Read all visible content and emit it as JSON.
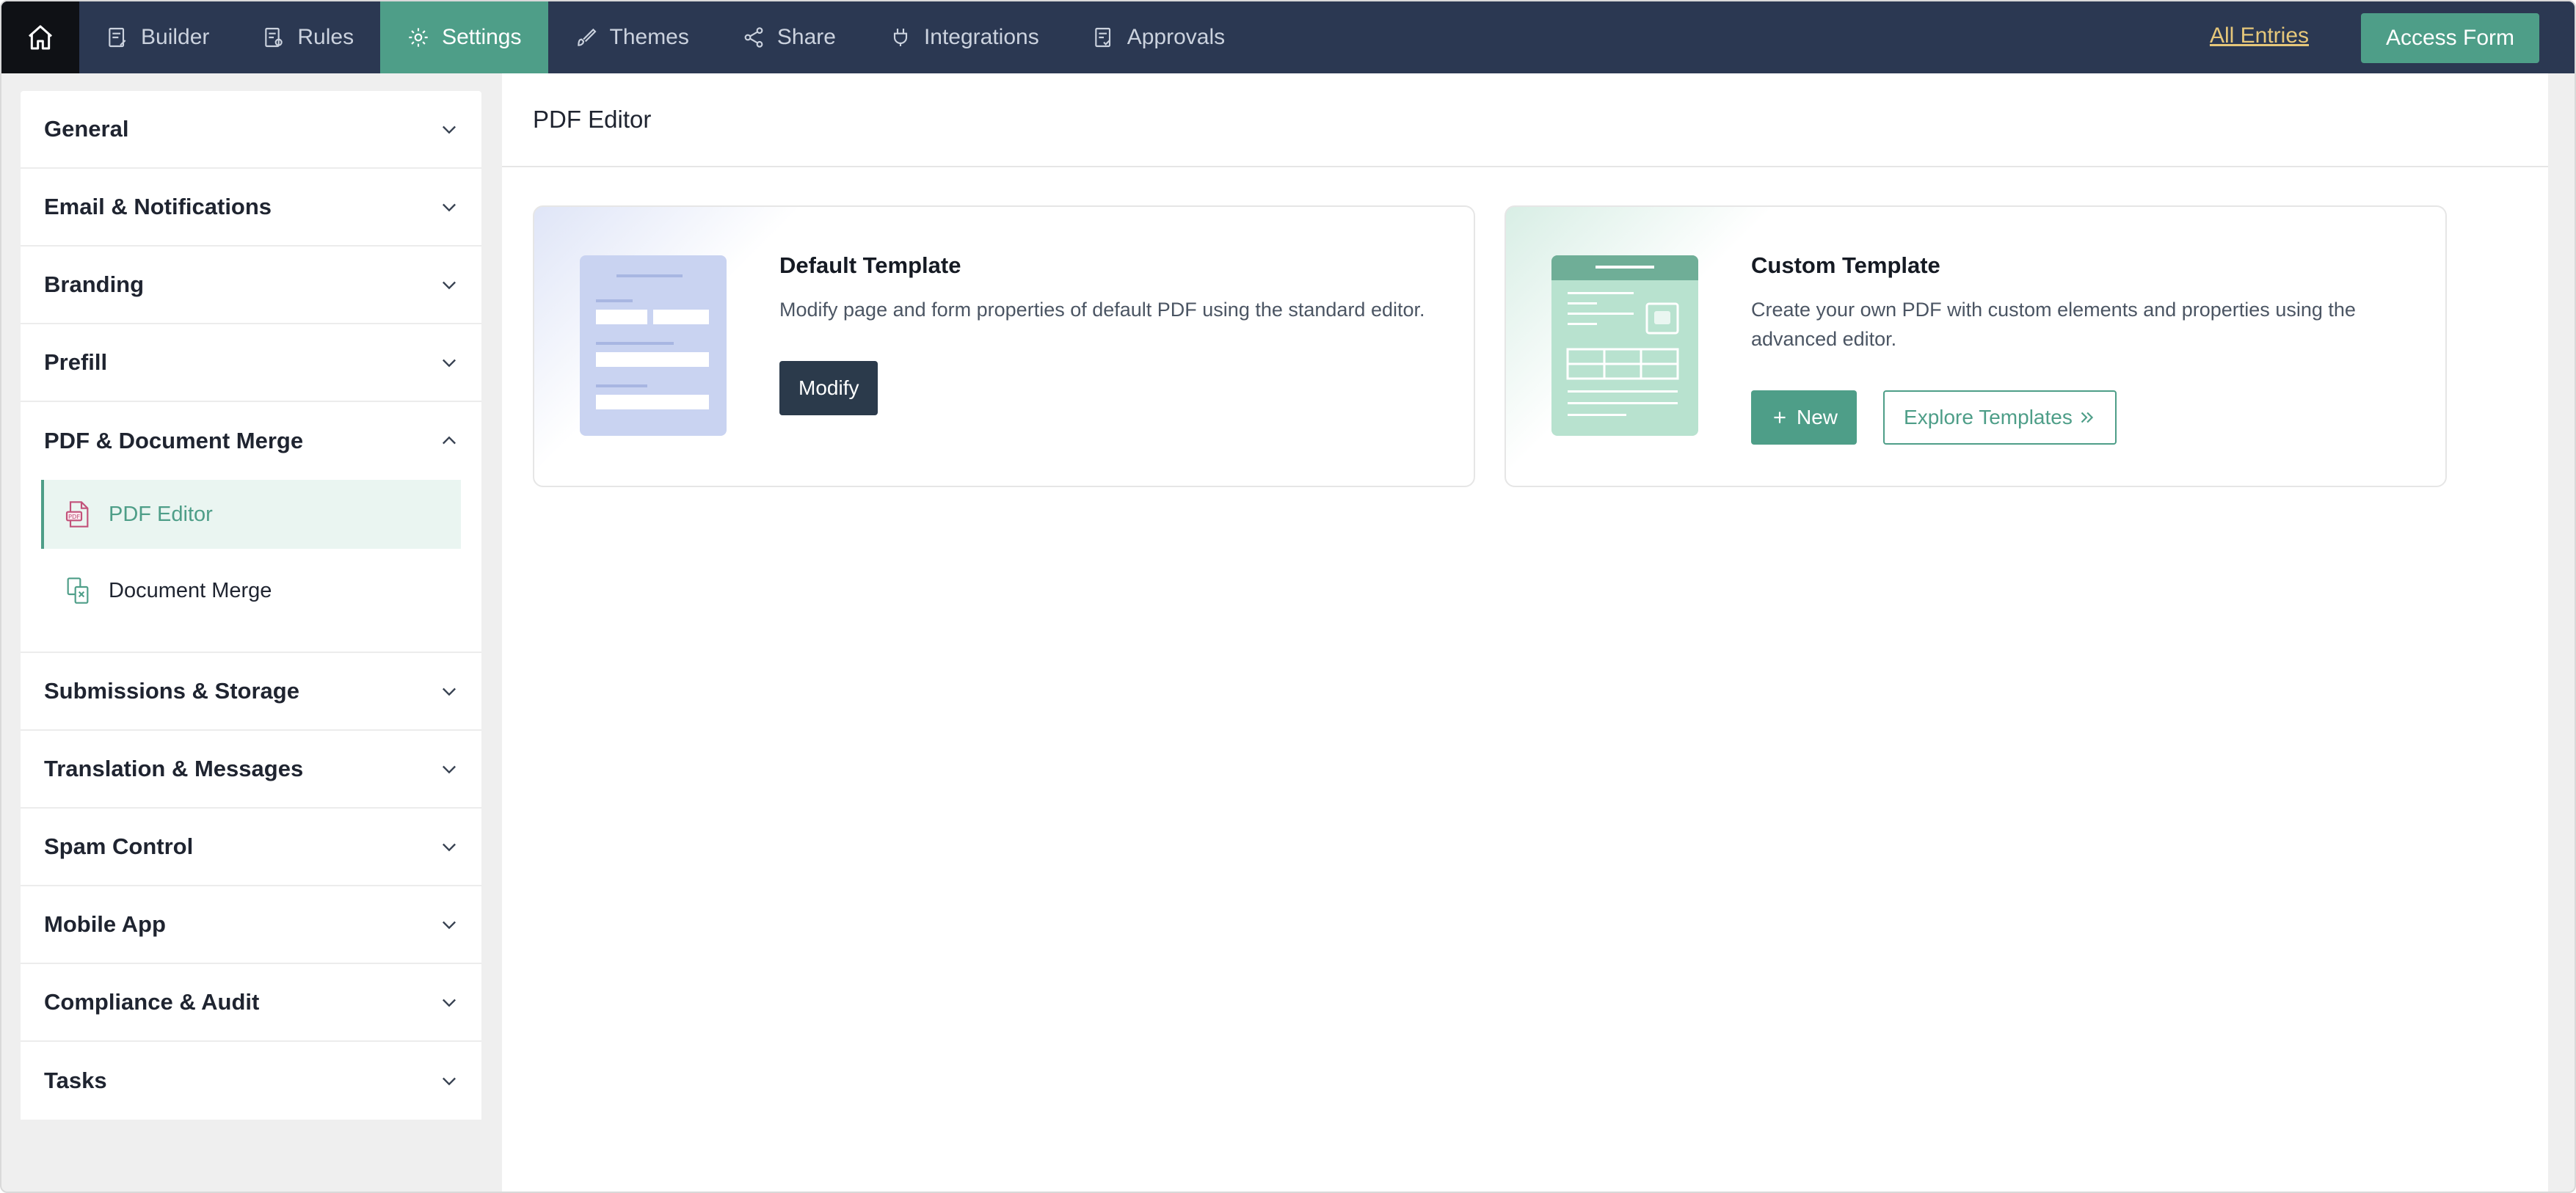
{
  "topbar": {
    "home_icon": "home-icon",
    "nav": [
      {
        "label": "Builder",
        "icon": "builder-icon",
        "active": false
      },
      {
        "label": "Rules",
        "icon": "rules-icon",
        "active": false
      },
      {
        "label": "Settings",
        "icon": "gear-icon",
        "active": true
      },
      {
        "label": "Themes",
        "icon": "brush-icon",
        "active": false
      },
      {
        "label": "Share",
        "icon": "share-icon",
        "active": false
      },
      {
        "label": "Integrations",
        "icon": "plug-icon",
        "active": false
      },
      {
        "label": "Approvals",
        "icon": "approvals-icon",
        "active": false
      }
    ],
    "all_entries": "All Entries",
    "access_form": "Access Form"
  },
  "sidebar": {
    "sections": [
      {
        "label": "General"
      },
      {
        "label": "Email & Notifications"
      },
      {
        "label": "Branding"
      },
      {
        "label": "Prefill"
      },
      {
        "label": "PDF & Document Merge",
        "expanded": true,
        "items": [
          {
            "label": "PDF Editor",
            "icon": "pdf-file-icon",
            "active": true
          },
          {
            "label": "Document Merge",
            "icon": "document-merge-icon",
            "active": false
          }
        ]
      },
      {
        "label": "Submissions & Storage"
      },
      {
        "label": "Translation & Messages"
      },
      {
        "label": "Spam Control"
      },
      {
        "label": "Mobile App"
      },
      {
        "label": "Compliance & Audit"
      },
      {
        "label": "Tasks"
      }
    ]
  },
  "main": {
    "title": "PDF Editor",
    "cards": [
      {
        "title": "Default Template",
        "description": "Modify page and form properties of default PDF using the standard editor.",
        "buttons": [
          {
            "label": "Modify"
          }
        ]
      },
      {
        "title": "Custom Template",
        "description": "Create your own PDF with custom elements and properties using the advanced editor.",
        "buttons": [
          {
            "label": "New"
          },
          {
            "label": "Explore Templates"
          }
        ]
      }
    ]
  },
  "colors": {
    "topbar": "#2b3852",
    "accent": "#4e9e88",
    "home_bg": "#0f1115",
    "all_entries_link": "#e6c77a",
    "modify_button": "#2b3a4b"
  }
}
